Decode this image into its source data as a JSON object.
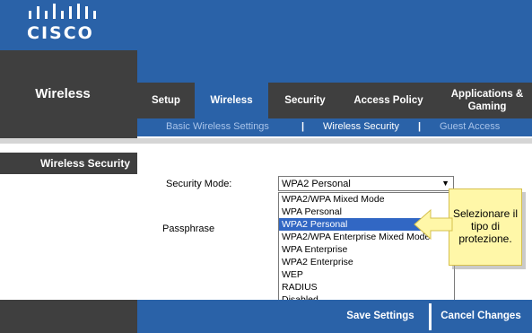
{
  "brand": {
    "logo_text": "CISCO",
    "logo_icon": "cisco-bars-icon"
  },
  "section": {
    "title": "Wireless"
  },
  "tabs": [
    {
      "label": "Setup"
    },
    {
      "label": "Wireless",
      "active": true
    },
    {
      "label": "Security"
    },
    {
      "label": "Access Policy"
    },
    {
      "label": "Applications & Gaming"
    }
  ],
  "subtabs": [
    {
      "label": "Basic Wireless Settings"
    },
    {
      "label": "Wireless Security",
      "active": true
    },
    {
      "label": "Guest Access"
    }
  ],
  "subtab_separator": "|",
  "sidebar": {
    "label": "Wireless Security"
  },
  "form": {
    "security_mode_label": "Security Mode:",
    "security_mode_value": "WPA2 Personal",
    "passphrase_label": "Passphrase"
  },
  "dropdown_options": [
    "WPA2/WPA Mixed Mode",
    "WPA Personal",
    "WPA2 Personal",
    "WPA2/WPA Enterprise Mixed Mode",
    "WPA Enterprise",
    "WPA2 Enterprise",
    "WEP",
    "RADIUS",
    "Disabled"
  ],
  "dropdown_selected_index": 2,
  "callout": {
    "text": "Selezionare il tipo di protezione."
  },
  "buttons": {
    "save": "Save Settings",
    "cancel": "Cancel Changes"
  },
  "colors": {
    "brand_blue": "#2a62a8",
    "dark_gray": "#3f3f3f",
    "selection_blue": "#3167c4",
    "callout_yellow": "#fff7a8"
  }
}
